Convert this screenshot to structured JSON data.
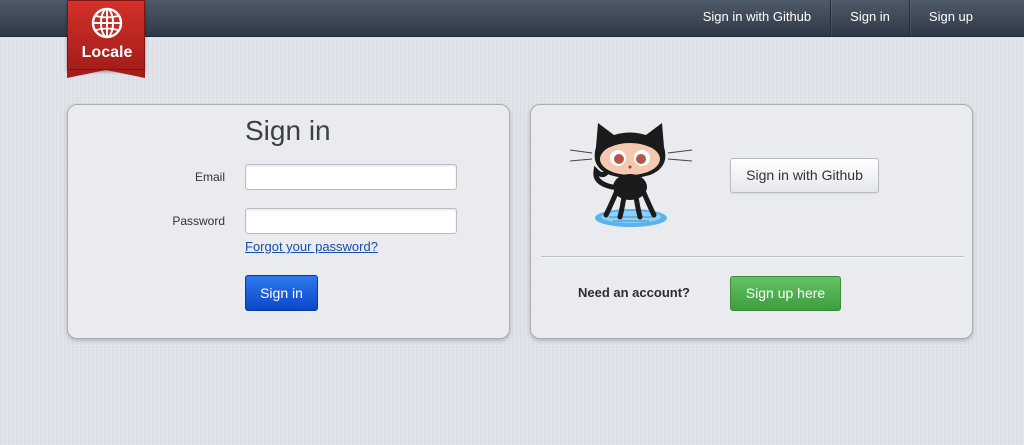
{
  "nav": {
    "github_label": "Sign in with Github",
    "signin_label": "Sign in",
    "signup_label": "Sign up"
  },
  "logo": {
    "text": "Locale"
  },
  "signin_form": {
    "title": "Sign in",
    "email_label": "Email",
    "email_value": "",
    "password_label": "Password",
    "password_value": "",
    "forgot_link": "Forgot your password?",
    "submit_label": "Sign in"
  },
  "github_panel": {
    "github_button": "Sign in with Github",
    "need_account": "Need an account?",
    "signup_button": "Sign up here"
  },
  "icons": {
    "logo": "globe-icon",
    "mascot": "octocat-icon"
  },
  "colors": {
    "topbar": "#3b4453",
    "logo_red": "#c02622",
    "primary_blue": "#1459d9",
    "success_green": "#51b051",
    "link": "#1a4fa8"
  }
}
